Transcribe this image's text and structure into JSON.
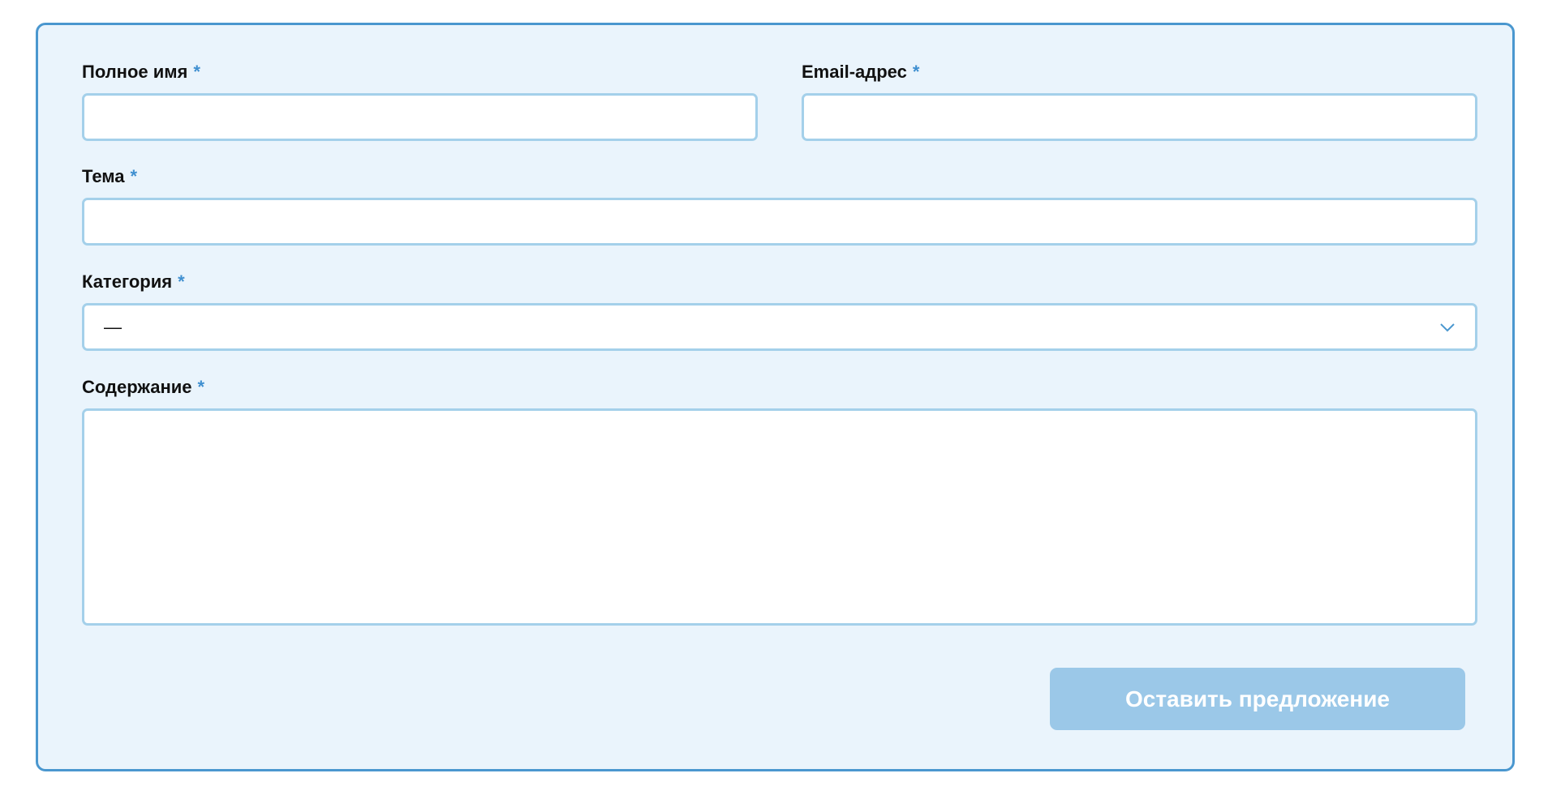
{
  "form": {
    "required_marker": "*",
    "full_name": {
      "label": "Полное имя",
      "value": "",
      "placeholder": ""
    },
    "email": {
      "label": "Email-адрес",
      "value": "",
      "placeholder": ""
    },
    "subject": {
      "label": "Тема",
      "value": "",
      "placeholder": ""
    },
    "category": {
      "label": "Категория",
      "selected": "—"
    },
    "content": {
      "label": "Содержание",
      "value": "",
      "placeholder": ""
    },
    "submit_label": "Оставить предложение"
  },
  "colors": {
    "panel_background": "#eaf4fc",
    "panel_border": "#4a97cf",
    "input_border": "#a4d0ea",
    "required_marker": "#3f8fd0",
    "button_background": "#9bc8e8"
  },
  "icons": {
    "select_arrow": "chevron-down-icon"
  }
}
